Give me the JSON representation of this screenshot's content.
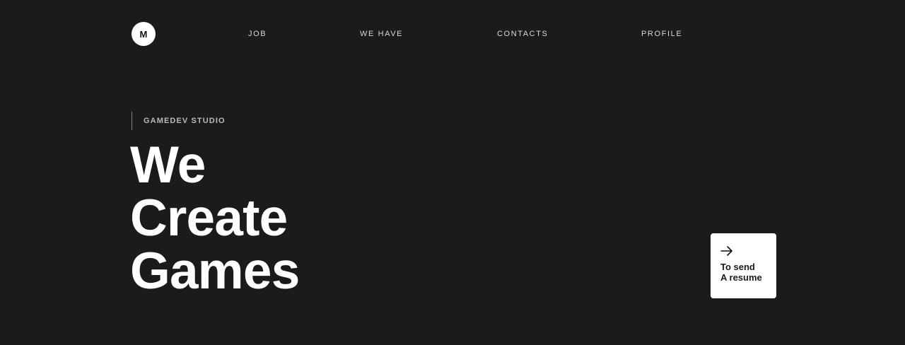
{
  "header": {
    "logo_letter": "M",
    "nav": [
      {
        "label": "JOB"
      },
      {
        "label": "WE HAVE"
      },
      {
        "label": "CONTACTS"
      },
      {
        "label": "PROFILE"
      }
    ]
  },
  "hero": {
    "eyebrow": "GAMEDEV STUDIO",
    "title_lines": [
      "We",
      "Create",
      "Games"
    ]
  },
  "cta_card": {
    "icon": "arrow-right-icon",
    "lines": [
      "To send",
      "A resume"
    ]
  },
  "colors": {
    "background": "#1b1b1b",
    "text": "#ffffff",
    "card_background": "#ffffff",
    "card_text": "#1b1b1b"
  }
}
